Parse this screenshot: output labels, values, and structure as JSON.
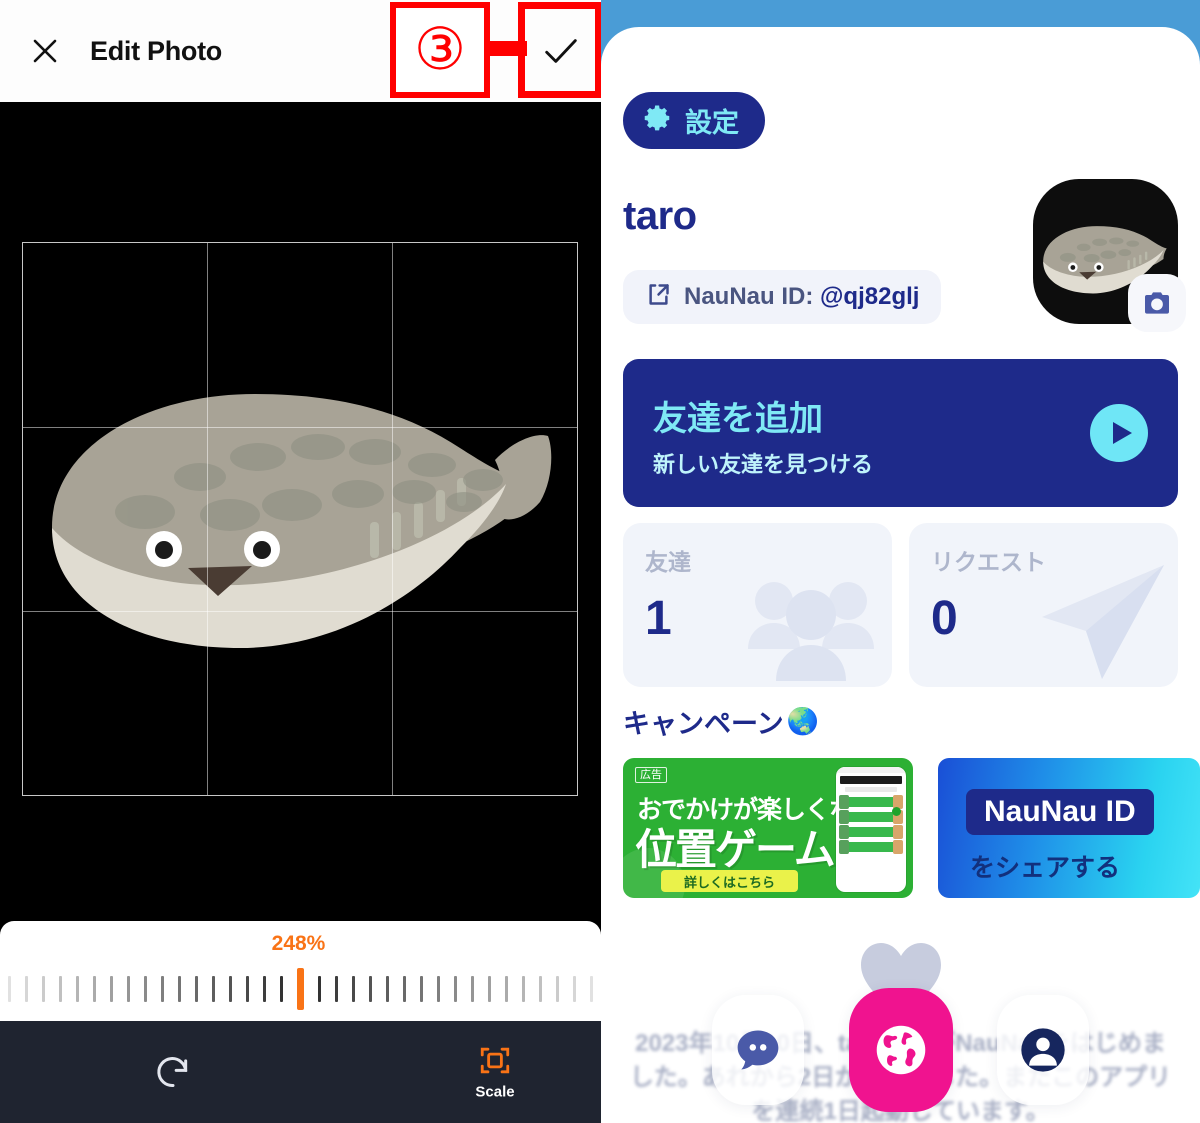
{
  "left_panel": {
    "app": "photo-editor",
    "topbar": {
      "close_icon": "close-x-icon",
      "title": "Edit Photo",
      "confirm_icon": "checkmark-icon"
    },
    "canvas": {
      "subject": "pufferfish-illustration",
      "background_color": "#000000",
      "crop_grid": "rule-of-thirds"
    },
    "scale": {
      "value_label": "248%",
      "value_number": 248,
      "accent_color": "#f97316",
      "tick_count": 35,
      "active_tick_index": 17
    },
    "bottombar": {
      "rotate_icon": "rotate-clockwise-icon",
      "scale_icon": "scale-crop-icon",
      "scale_label": "Scale",
      "background_color": "#1f2430"
    },
    "annotations": {
      "step_number": "③",
      "color": "#ff0000"
    }
  },
  "right_panel": {
    "app": "NauNau",
    "background_color": "#4a9cd6",
    "settings_button": {
      "label": "設定",
      "icon": "gear-icon",
      "bg": "#1e2a8a",
      "fg": "#7fe9f5"
    },
    "profile": {
      "username": "taro",
      "id_prefix": "NauNau ID: ",
      "id_value": "@qj82glj",
      "share_icon": "share-arrow-icon",
      "avatar_name": "pufferfish-avatar",
      "camera_icon": "camera-icon"
    },
    "add_friend_card": {
      "title": "友達を追加",
      "subtitle": "新しい友達を見つける",
      "play_icon": "play-circle-icon",
      "bg": "#1e2a8a",
      "title_color": "#7fe9f5"
    },
    "stats": [
      {
        "label": "友達",
        "value": "1",
        "art": "people-group-icon"
      },
      {
        "label": "リクエスト",
        "value": "0",
        "art": "paper-plane-icon"
      }
    ],
    "campaign": {
      "title": "キャンペーン",
      "emoji": "🌏",
      "banners": [
        {
          "type": "ad",
          "ad_tag": "広告",
          "line1": "おでかけが楽しくなる",
          "line2": "位置ゲーム",
          "cta": "詳しくはこちら",
          "bg": "#2cb034",
          "cta_bg": "#eaf24a"
        },
        {
          "type": "share",
          "badge": "NauNau ID",
          "text": "をシェアする",
          "bg_gradient": "#1a4fd6 → #44e3f7"
        }
      ]
    },
    "history_text": "2023年10月10日、taroさんがNauNauをはじめました。あれから2日が経ちました。またこのアプリを連続1日起動しています。",
    "bottom_nav": [
      {
        "name": "chat",
        "icon": "chat-bubble-icon",
        "active": false
      },
      {
        "name": "map",
        "icon": "globe-icon",
        "active": true,
        "bg": "#f0138f"
      },
      {
        "name": "profile",
        "icon": "person-icon",
        "active": false
      }
    ],
    "heart_icon": "heart-icon"
  }
}
